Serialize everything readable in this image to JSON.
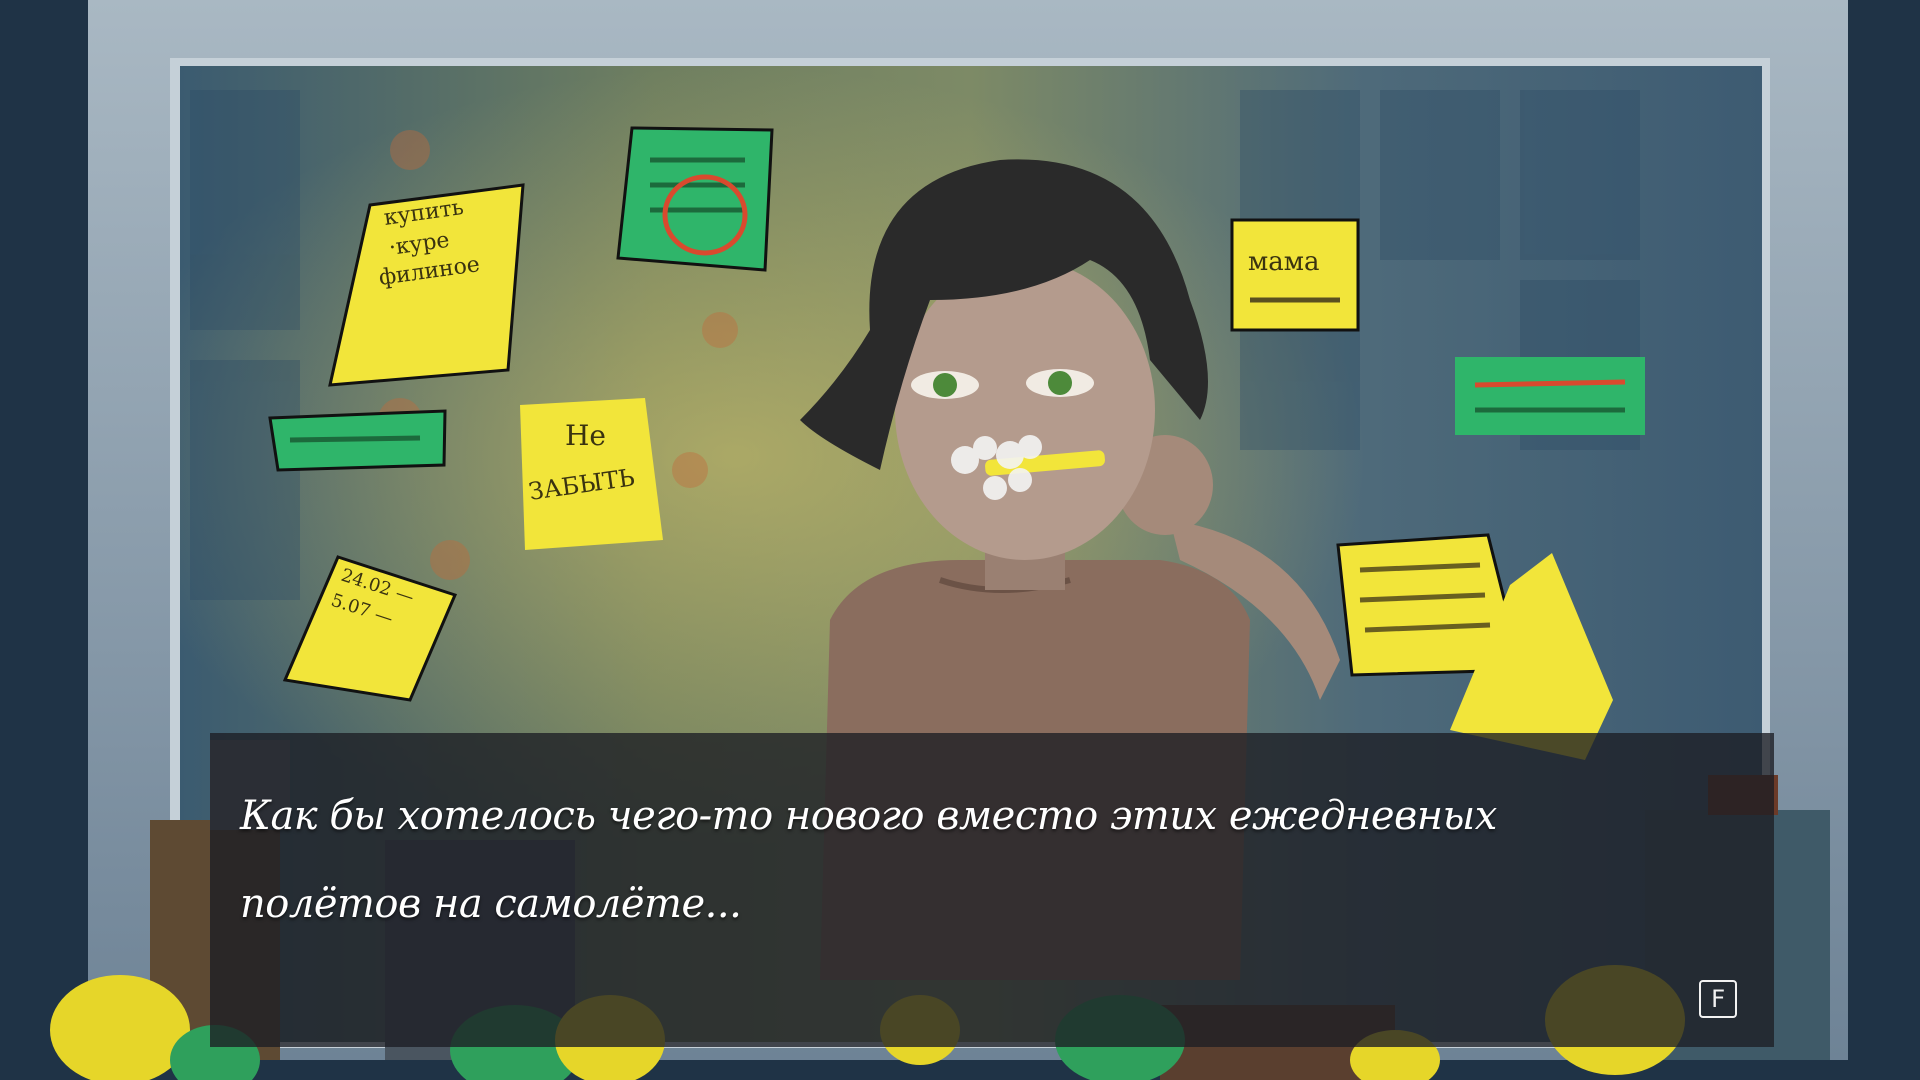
{
  "dialog": {
    "text": "Как бы хотелось чего-то нового вместо этих ежедневных полётов на самолёте..."
  },
  "key_hint": {
    "label": "F"
  },
  "notes": {
    "buy_list": [
      "купить",
      "·куре",
      "филиное"
    ],
    "dont_forget": [
      "Не",
      "ЗАБЫТЬ"
    ],
    "mom": "мама",
    "dates": [
      "24.02 —",
      "5.07 —"
    ]
  },
  "colors": {
    "sticky_yellow": "#f2e53a",
    "sticky_green": "#2fb56a",
    "wall": "#1f3346",
    "mirror_frame": "#8fa2b4",
    "dialog_bg": "#1c1e24"
  }
}
